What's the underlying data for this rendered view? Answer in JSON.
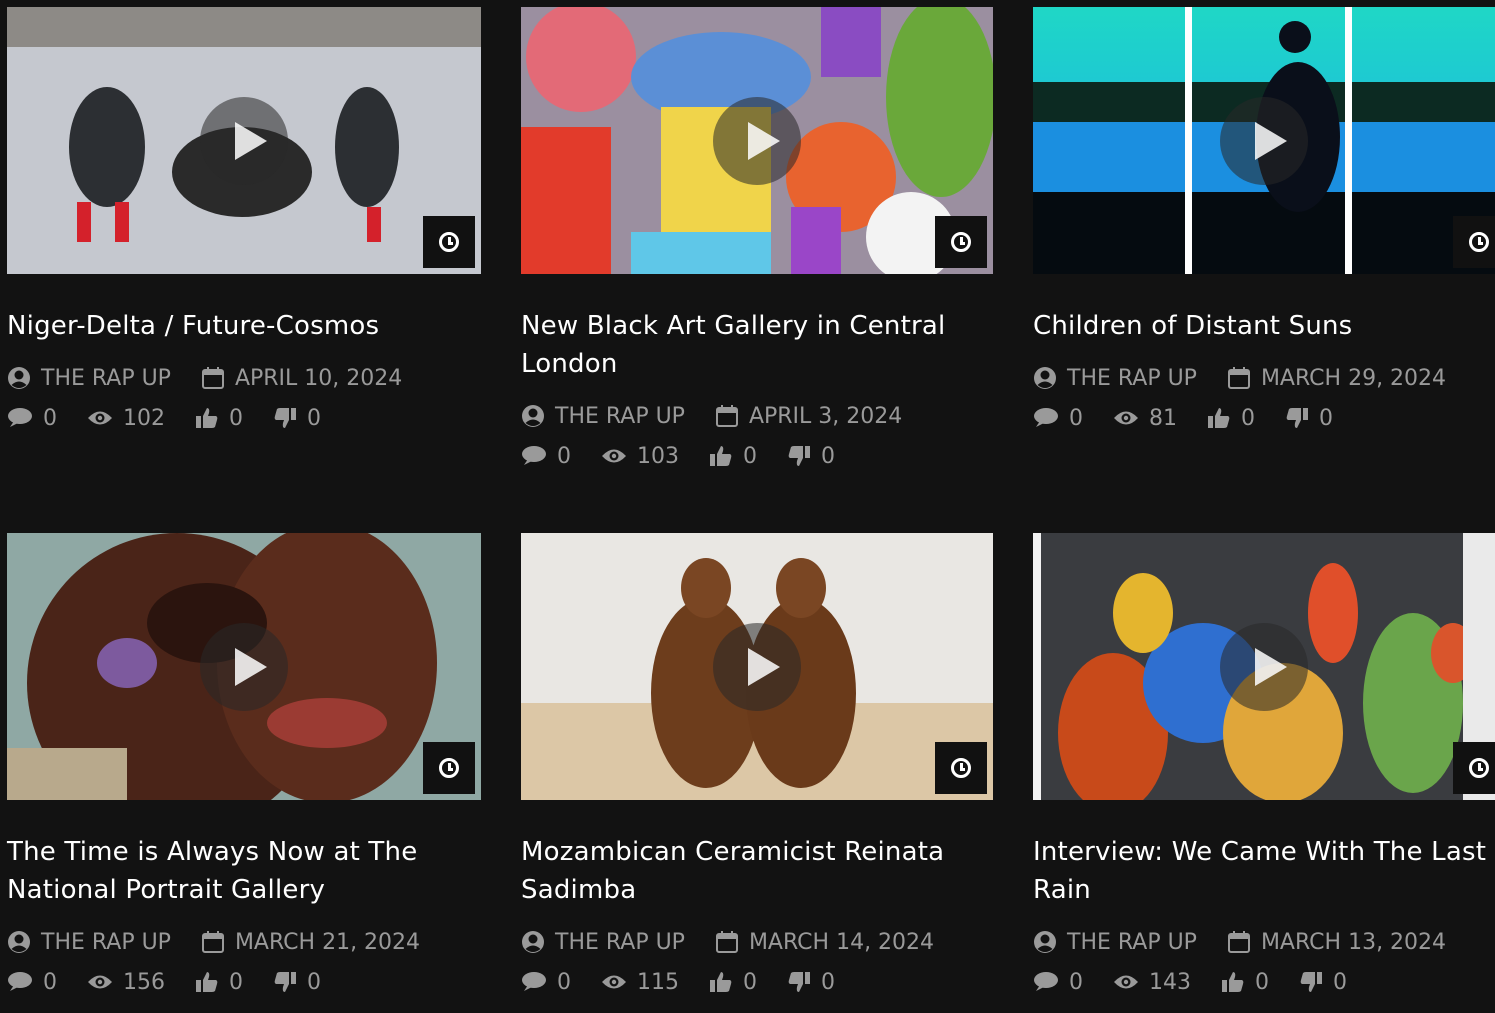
{
  "cards": [
    {
      "title": "Niger-Delta / Future-Cosmos",
      "author": "THE RAP UP",
      "date": "APRIL 10, 2024",
      "comments": "0",
      "views": "102",
      "likes": "0",
      "dislikes": "0"
    },
    {
      "title": "New Black Art Gallery in Central London",
      "author": "THE RAP UP",
      "date": "APRIL 3, 2024",
      "comments": "0",
      "views": "103",
      "likes": "0",
      "dislikes": "0"
    },
    {
      "title": "Children of Distant Suns",
      "author": "THE RAP UP",
      "date": "MARCH 29, 2024",
      "comments": "0",
      "views": "81",
      "likes": "0",
      "dislikes": "0"
    },
    {
      "title": "The Time is Always Now at The National Portrait Gallery",
      "author": "THE RAP UP",
      "date": "MARCH 21, 2024",
      "comments": "0",
      "views": "156",
      "likes": "0",
      "dislikes": "0"
    },
    {
      "title": "Mozambican Ceramicist Reinata Sadimba",
      "author": "THE RAP UP",
      "date": "MARCH 14, 2024",
      "comments": "0",
      "views": "115",
      "likes": "0",
      "dislikes": "0"
    },
    {
      "title": "Interview: We Came With The Last Rain",
      "author": "THE RAP UP",
      "date": "MARCH 13, 2024",
      "comments": "0",
      "views": "143",
      "likes": "0",
      "dislikes": "0"
    }
  ],
  "icons": {
    "play": "play-icon",
    "clock": "clock-icon",
    "author": "user-icon",
    "date": "calendar-icon",
    "comments": "comment-icon",
    "views": "eye-icon",
    "likes": "thumbs-up-icon",
    "dislikes": "thumbs-down-icon"
  },
  "colors": {
    "background": "#121212",
    "title": "#ffffff",
    "meta": "#9a9a9a"
  }
}
